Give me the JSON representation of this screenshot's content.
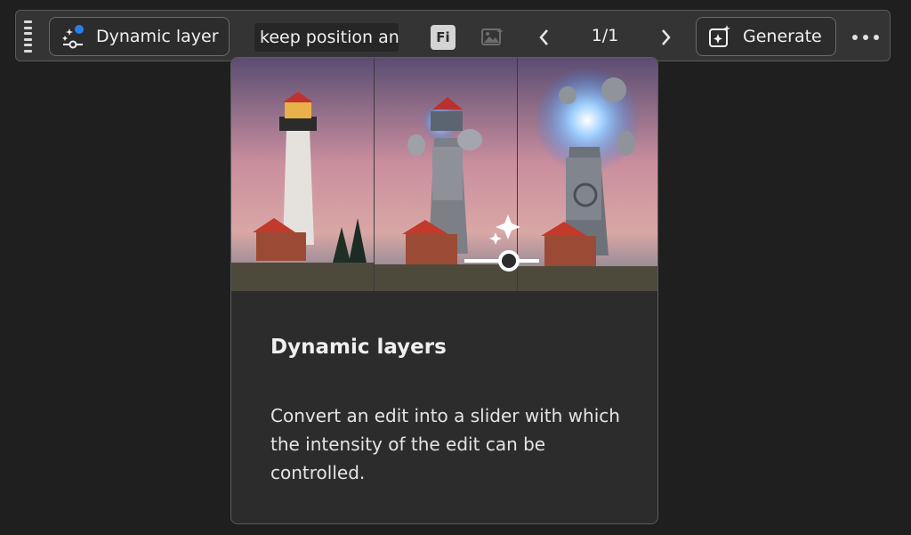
{
  "toolbar": {
    "dynamic_layer_label": "Dynamic layer",
    "prompt_value": "keep position and",
    "fi_badge": "Fi",
    "page_counter": "1/1",
    "generate_label": "Generate"
  },
  "icons": {
    "drag": "drag-handle-icon",
    "dynamic_layer": "dynamic-layer-icon",
    "model": "firefly-badge-icon",
    "reference_image": "image-reference-icon",
    "prev": "chevron-left-icon",
    "next": "chevron-right-icon",
    "generate": "generate-sparkle-icon",
    "more": "more-options-icon"
  },
  "popover": {
    "title": "Dynamic layers",
    "description": "Convert an edit into a slider with which the intensity of the edit can be controlled."
  },
  "colors": {
    "accent": "#2680eb",
    "background": "#1f1f1f",
    "toolbar": "#343434",
    "popover": "#2c2c2c"
  }
}
